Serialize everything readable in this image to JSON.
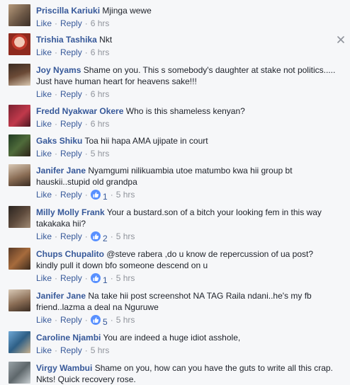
{
  "actions": {
    "like": "Like",
    "reply": "Reply",
    "sep": "·"
  },
  "colors": {
    "name": "#365899",
    "like_badge": "#5890ff",
    "meta": "#90949c"
  },
  "comments": [
    {
      "author": "Priscilla Kariuki",
      "text": "Mjinga wewe",
      "time": "6 hrs",
      "likes": ""
    },
    {
      "author": "Trishia Tashika",
      "text": "Nkt",
      "time": "6 hrs",
      "likes": ""
    },
    {
      "author": "Joy Nyams",
      "text": "Shame on you. This s somebody's daughter at stake not politics..... Just have human heart for heavens sake!!!",
      "time": "6 hrs",
      "likes": ""
    },
    {
      "author": "Fredd Nyakwar Okere",
      "text": "Who is this shameless kenyan?",
      "time": "6 hrs",
      "likes": ""
    },
    {
      "author": "Gaks Shiku",
      "text": "Toa hii hapa AMA ujipate in court",
      "time": "5 hrs",
      "likes": ""
    },
    {
      "author": "Janifer Jane",
      "text": "Nyamgumi nilikuambia utoe matumbo kwa hii group bt hauskii..stupid old grandpa",
      "time": "5 hrs",
      "likes": "1"
    },
    {
      "author": "Milly Molly Frank",
      "text": "Your a bustard.son of a bitch your looking fem in this way takakaka hii?",
      "time": "5 hrs",
      "likes": "2"
    },
    {
      "author": "Chups Chupalito",
      "text": "@steve rabera ,do u know de repercussion of ua post? kindly pull it down bfo someone descend on u",
      "time": "5 hrs",
      "likes": "1"
    },
    {
      "author": "Janifer Jane",
      "text": "Na take hii post screenshot NA TAG Raila ndani..he's my fb friend..lazma a deal na Nguruwe",
      "time": "5 hrs",
      "likes": "5"
    },
    {
      "author": "Caroline Njambi",
      "text": "You are indeed a huge idiot asshole,",
      "time": "5 hrs",
      "likes": ""
    },
    {
      "author": "Virgy Wambui",
      "text": "Shame on you, how can you have the guts to write all this crap. Nkts! Quick recovery rose.",
      "time": "",
      "likes": ""
    }
  ]
}
